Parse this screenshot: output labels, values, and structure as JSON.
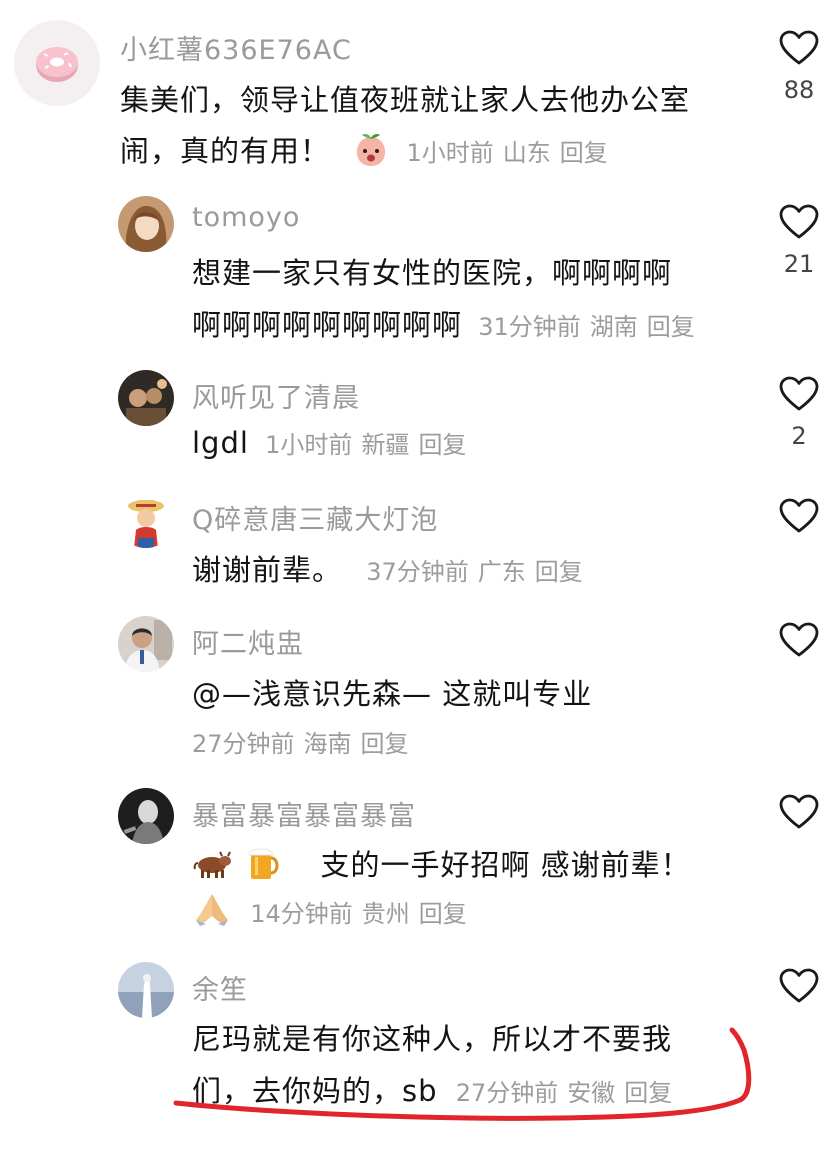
{
  "comments": [
    {
      "username": "小红薯636E76AC",
      "lines": [
        "集美们，领导让值夜班就让家人去他办公室",
        "闹，真的有用！"
      ],
      "time": "1小时前",
      "location": "山东",
      "reply": "回复",
      "likes": "88",
      "avatar_icon": "donut-icon",
      "emoji_icon": "peach-face-icon"
    },
    {
      "username": "tomoyo",
      "lines": [
        "想建一家只有女性的医院，啊啊啊啊",
        "啊啊啊啊啊啊啊啊啊"
      ],
      "time": "31分钟前",
      "location": "湖南",
      "reply": "回复",
      "likes": "21"
    },
    {
      "username": "风听见了清晨",
      "lines": [
        "lgdl"
      ],
      "time": "1小时前",
      "location": "新疆",
      "reply": "回复",
      "likes": "2"
    },
    {
      "username": "Q碎意唐三藏大灯泡",
      "lines": [
        "谢谢前辈。"
      ],
      "time": "37分钟前",
      "location": "广东",
      "reply": "回复",
      "likes": ""
    },
    {
      "username": "阿二炖盅",
      "lines": [
        "@—浅意识先森— 这就叫专业"
      ],
      "time": "27分钟前",
      "location": "海南",
      "reply": "回复",
      "likes": ""
    },
    {
      "username": "暴富暴富暴富暴富",
      "lines": [
        "支的一手好招啊   感谢前辈！"
      ],
      "time": "14分钟前",
      "location": "贵州",
      "reply": "回复",
      "likes": "",
      "emoji_icons": [
        "cow-icon",
        "beer-icon",
        "praying-hands-icon"
      ]
    },
    {
      "username": "余笙",
      "lines": [
        "尼玛就是有你这种人，所以才不要我",
        "们，去你妈的，sb"
      ],
      "time": "27分钟前",
      "location": "安徽",
      "reply": "回复",
      "likes": ""
    }
  ],
  "colors": {
    "username": "#9a9a9a",
    "text": "#141414",
    "meta": "#9c9c9c",
    "annotation": "#e0262c"
  }
}
